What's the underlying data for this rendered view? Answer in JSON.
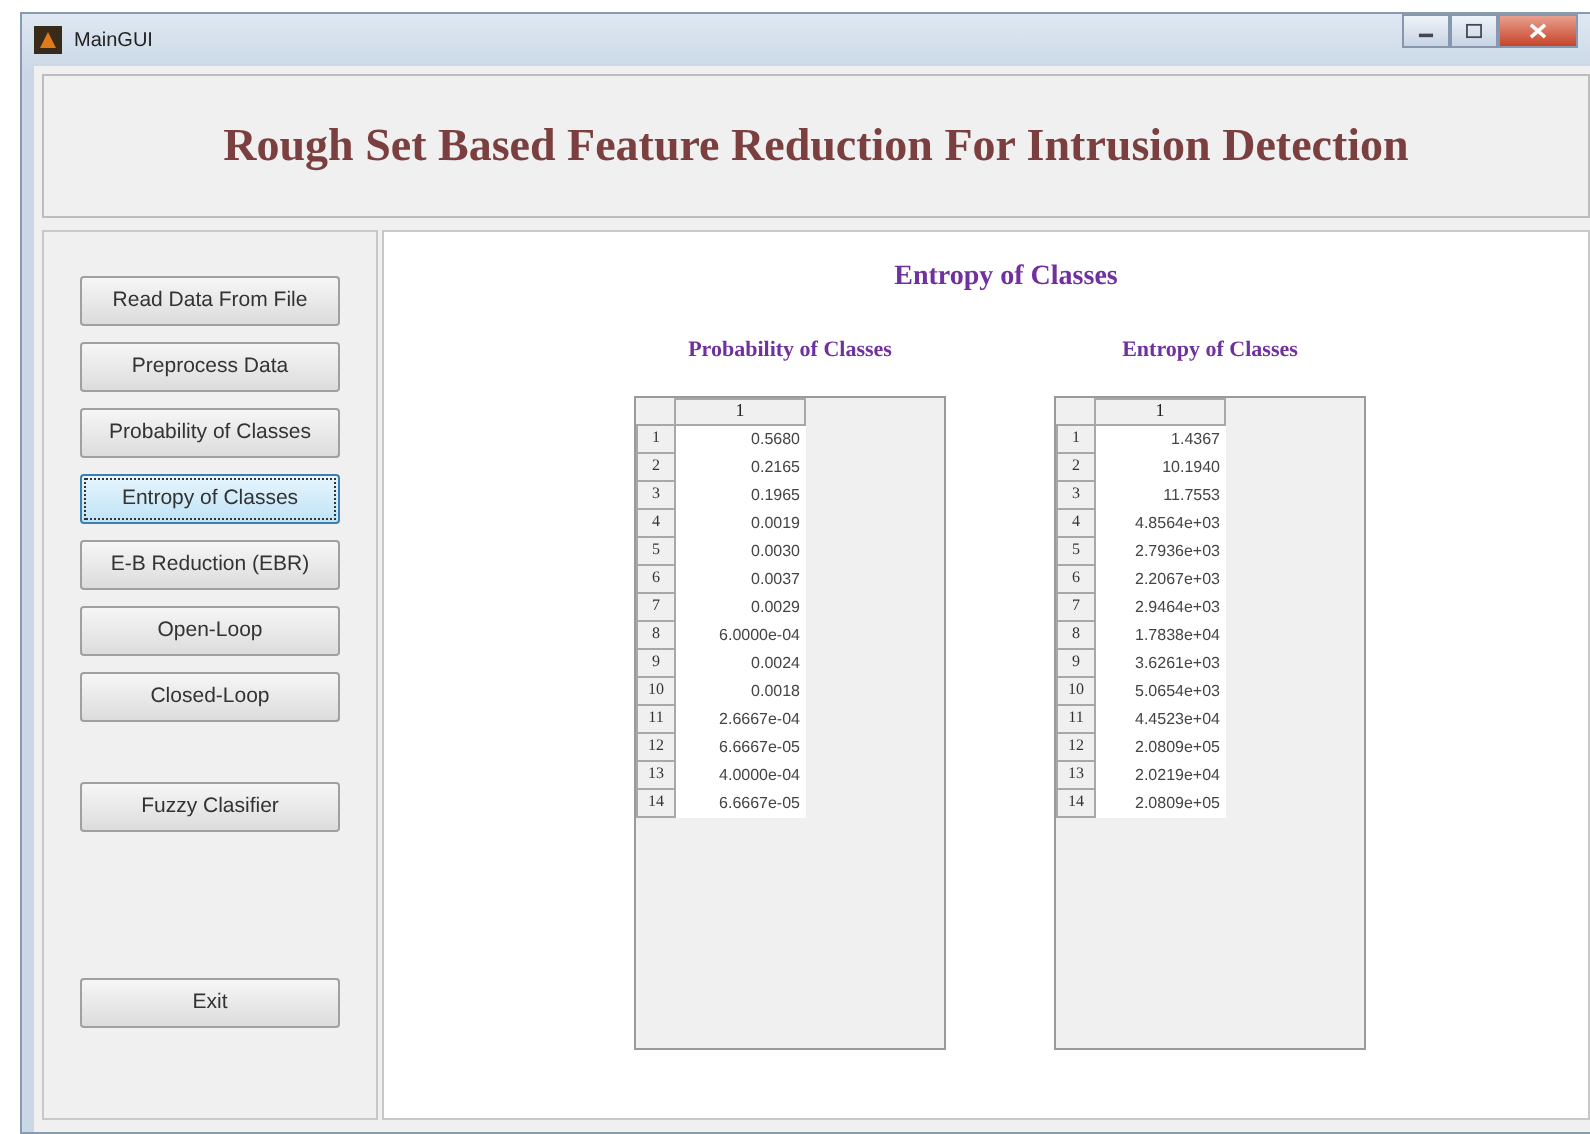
{
  "window": {
    "title": "MainGUI"
  },
  "header": {
    "title": "Rough Set Based Feature Reduction For Intrusion Detection"
  },
  "sidebar": {
    "buttons": [
      {
        "label": "Read Data From File",
        "selected": false
      },
      {
        "label": "Preprocess Data",
        "selected": false
      },
      {
        "label": "Probability of Classes",
        "selected": false
      },
      {
        "label": "Entropy of Classes",
        "selected": true
      },
      {
        "label": "E-B Reduction (EBR)",
        "selected": false
      },
      {
        "label": "Open-Loop",
        "selected": false
      },
      {
        "label": "Closed-Loop",
        "selected": false
      },
      {
        "label": "Fuzzy Clasifier",
        "selected": false
      }
    ],
    "exit_button": "Exit"
  },
  "main": {
    "title": "Entropy of Classes",
    "tables": [
      {
        "title": "Probability of Classes",
        "column": "1",
        "row_labels": [
          "1",
          "2",
          "3",
          "4",
          "5",
          "6",
          "7",
          "8",
          "9",
          "10",
          "11",
          "12",
          "13",
          "14"
        ],
        "values": [
          "0.5680",
          "0.2165",
          "0.1965",
          "0.0019",
          "0.0030",
          "0.0037",
          "0.0029",
          "6.0000e-04",
          "0.0024",
          "0.0018",
          "2.6667e-04",
          "6.6667e-05",
          "4.0000e-04",
          "6.6667e-05"
        ]
      },
      {
        "title": "Entropy of Classes",
        "column": "1",
        "row_labels": [
          "1",
          "2",
          "3",
          "4",
          "5",
          "6",
          "7",
          "8",
          "9",
          "10",
          "11",
          "12",
          "13",
          "14"
        ],
        "values": [
          "1.4367",
          "10.1940",
          "11.7553",
          "4.8564e+03",
          "2.7936e+03",
          "2.2067e+03",
          "2.9464e+03",
          "1.7838e+04",
          "3.6261e+03",
          "5.0654e+03",
          "4.4523e+04",
          "2.0809e+05",
          "2.0219e+04",
          "2.0809e+05"
        ]
      }
    ]
  }
}
